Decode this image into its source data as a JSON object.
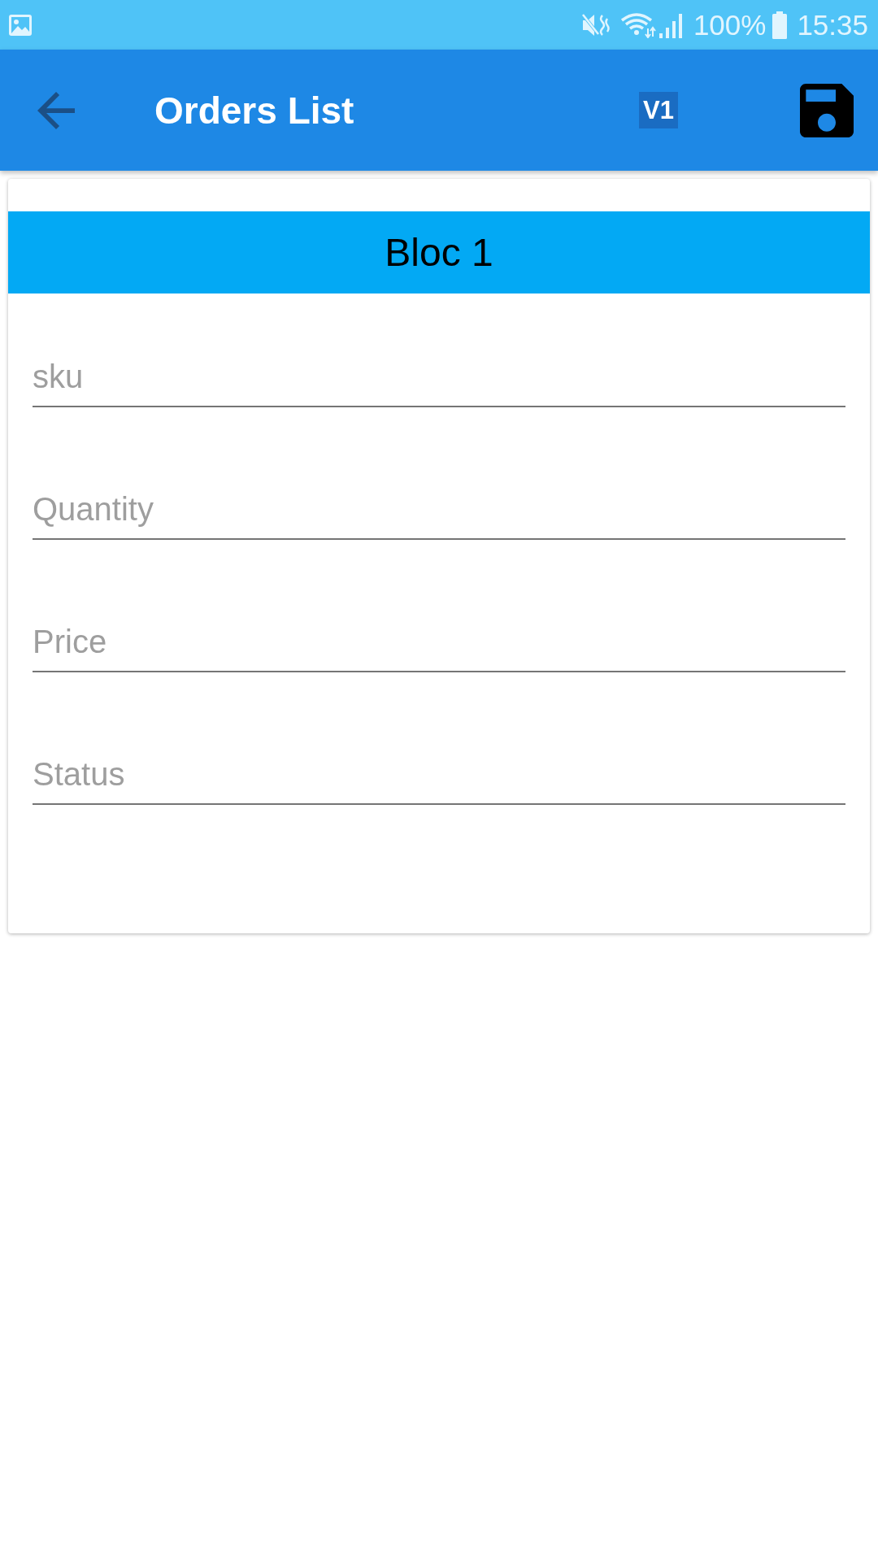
{
  "status_bar": {
    "battery": "100%",
    "time": "15:35"
  },
  "app_bar": {
    "title": "Orders List",
    "badge": "V1"
  },
  "card": {
    "title": "Bloc 1",
    "fields": [
      {
        "placeholder": "sku"
      },
      {
        "placeholder": "Quantity"
      },
      {
        "placeholder": "Price"
      },
      {
        "placeholder": "Status"
      }
    ]
  }
}
